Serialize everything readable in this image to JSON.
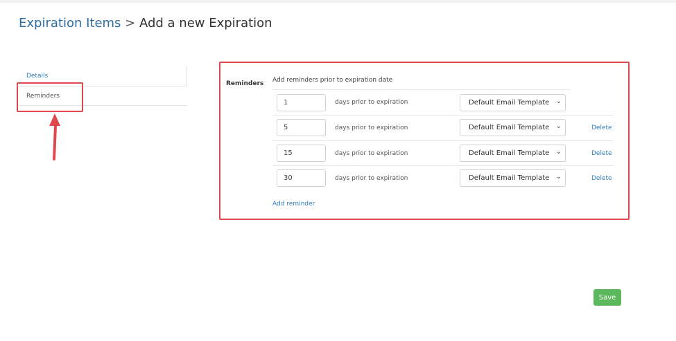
{
  "breadcrumb": {
    "parent": "Expiration Items",
    "separator": " > ",
    "current": "Add a new Expiration"
  },
  "side_nav": {
    "items": [
      {
        "label": "Details"
      },
      {
        "label": "Reminders"
      }
    ]
  },
  "reminders": {
    "section_label": "Reminders",
    "description": "Add reminders prior to expiration date",
    "days_suffix": "days prior to expiration",
    "rows": [
      {
        "days": "1",
        "template": "Default Email Template",
        "delete_label": ""
      },
      {
        "days": "5",
        "template": "Default Email Template",
        "delete_label": "Delete"
      },
      {
        "days": "15",
        "template": "Default Email Template",
        "delete_label": "Delete"
      },
      {
        "days": "30",
        "template": "Default Email Template",
        "delete_label": "Delete"
      }
    ],
    "add_label": "Add reminder"
  },
  "footer": {
    "save_label": "Save"
  },
  "colors": {
    "link": "#2f7cbc",
    "highlight": "#e0484d",
    "save": "#5cb85c"
  },
  "icons": {
    "select_caret": "chevron-down-icon",
    "annotation": "arrow-up-icon"
  }
}
